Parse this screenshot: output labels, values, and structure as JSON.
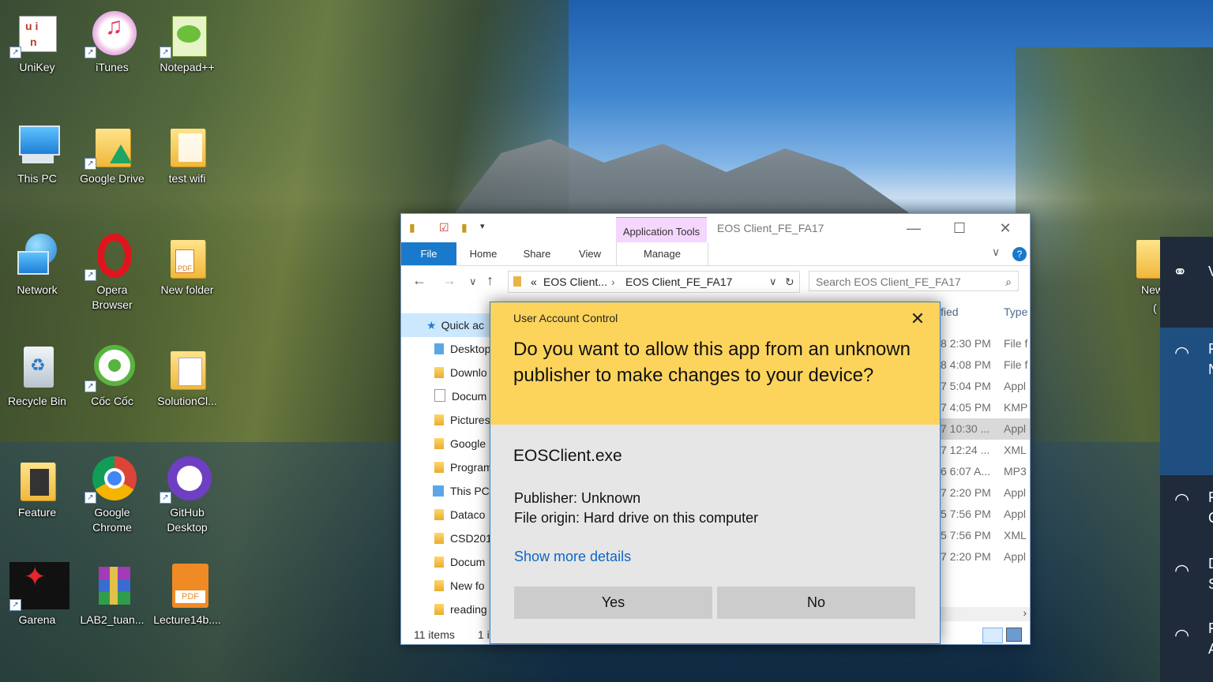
{
  "desktop": {
    "icons": [
      {
        "label": "UniKey"
      },
      {
        "label": "iTunes"
      },
      {
        "label": "Notepad++"
      },
      {
        "label": "This PC"
      },
      {
        "label": "Google Drive"
      },
      {
        "label": "test wifi"
      },
      {
        "label": "Network"
      },
      {
        "label": "Opera Browser"
      },
      {
        "label": "New folder"
      },
      {
        "label": "Recycle Bin"
      },
      {
        "label": "Cốc Cốc"
      },
      {
        "label": "SolutionCl..."
      },
      {
        "label": "Feature"
      },
      {
        "label": "Google Chrome"
      },
      {
        "label": "GitHub Desktop"
      },
      {
        "label": "Garena"
      },
      {
        "label": "LAB2_tuan..."
      },
      {
        "label": "Lecture14b...."
      }
    ],
    "right_icon": {
      "label": "New",
      "label2": "("
    }
  },
  "explorer": {
    "app_tools": "Application Tools",
    "title": "EOS Client_FE_FA17",
    "tabs": {
      "file": "File",
      "home": "Home",
      "share": "Share",
      "view": "View",
      "manage": "Manage"
    },
    "breadcrumb": {
      "sep": "«",
      "part1": "EOS Client...",
      "arrow": "›",
      "part2": "EOS Client_FE_FA17"
    },
    "search_placeholder": "Search EOS Client_FE_FA17",
    "nav": [
      "Quick acc",
      "Desktop",
      "Downlo",
      "Docum",
      "Pictures",
      "Google",
      "Program",
      "This PC",
      "Dataco",
      "CSD201",
      "Docum",
      "New fo",
      "reading"
    ],
    "col_modified": "fied",
    "col_type": "Type",
    "rows": [
      {
        "date": "8 2:30 PM",
        "type": "File f"
      },
      {
        "date": "8 4:08 PM",
        "type": "File f"
      },
      {
        "date": "7 5:04 PM",
        "type": "Appl"
      },
      {
        "date": "7 4:05 PM",
        "type": "KMP"
      },
      {
        "date": "7 10:30 ...",
        "type": "Appl"
      },
      {
        "date": "7 12:24 ...",
        "type": "XML"
      },
      {
        "date": "6 6:07 A...",
        "type": "MP3"
      },
      {
        "date": "7 2:20 PM",
        "type": "Appl"
      },
      {
        "date": "5 7:56 PM",
        "type": "Appl"
      },
      {
        "date": "5 7:56 PM",
        "type": "XML"
      },
      {
        "date": "7 2:20 PM",
        "type": "Appl"
      }
    ],
    "status_items": "11 items",
    "status_selected": "1 i"
  },
  "uac": {
    "caption": "User Account Control",
    "question": "Do you want to allow this app from an unknown publisher to make changes to your device?",
    "app_name": "EOSClient.exe",
    "publisher": "Publisher: Unknown",
    "origin": "File origin: Hard drive on this computer",
    "more": "Show more details",
    "yes": "Yes",
    "no": "No"
  },
  "flyout": {
    "t1": "V",
    "t2": "F",
    "t3": "N",
    "t4": "F",
    "t5": "C",
    "t6": "D",
    "t7": "S",
    "t8": "F",
    "t9": "A"
  },
  "colors": {
    "uac_header": "#fcd45c",
    "uac_body": "#e6e6e6",
    "accent": "#1979ca",
    "link": "#0d66c7"
  }
}
